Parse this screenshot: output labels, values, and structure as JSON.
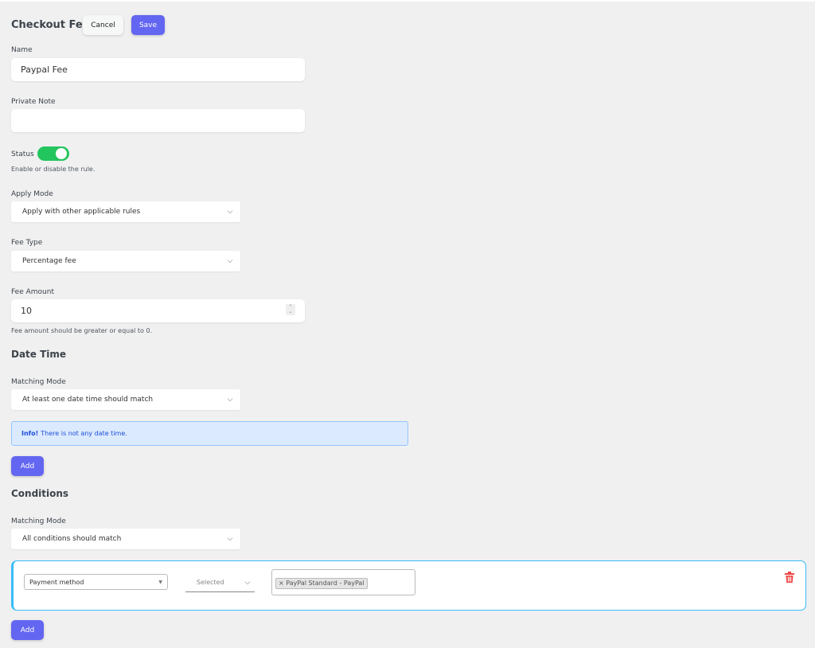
{
  "header": {
    "title": "Checkout Fees",
    "cancel_label": "Cancel",
    "save_label": "Save"
  },
  "form": {
    "name": {
      "label": "Name",
      "value": "Paypal Fee"
    },
    "private_note": {
      "label": "Private Note",
      "value": ""
    },
    "status": {
      "label": "Status",
      "enabled": true,
      "help": "Enable or disable the rule."
    },
    "apply_mode": {
      "label": "Apply Mode",
      "value": "Apply with other applicable rules"
    },
    "fee_type": {
      "label": "Fee Type",
      "value": "Percentage fee"
    },
    "fee_amount": {
      "label": "Fee Amount",
      "value": "10",
      "help": "Fee amount should be greater or equal to 0."
    }
  },
  "date_time": {
    "heading": "Date Time",
    "matching_mode_label": "Matching Mode",
    "matching_mode_value": "At least one date time should match",
    "info_strong": "Info!",
    "info_text": "There is not any date time.",
    "add_label": "Add"
  },
  "conditions": {
    "heading": "Conditions",
    "matching_mode_label": "Matching Mode",
    "matching_mode_value": "All conditions should match",
    "items": [
      {
        "type": "Payment method",
        "operator": "Selected",
        "values": [
          "PayPal Standard - PayPal"
        ]
      }
    ],
    "add_label": "Add"
  },
  "colors": {
    "primary": "#6366f1",
    "toggle_on": "#22c55e",
    "info_bg": "#dbeafe",
    "condition_border": "#38bdf8",
    "delete": "#ef4444"
  }
}
